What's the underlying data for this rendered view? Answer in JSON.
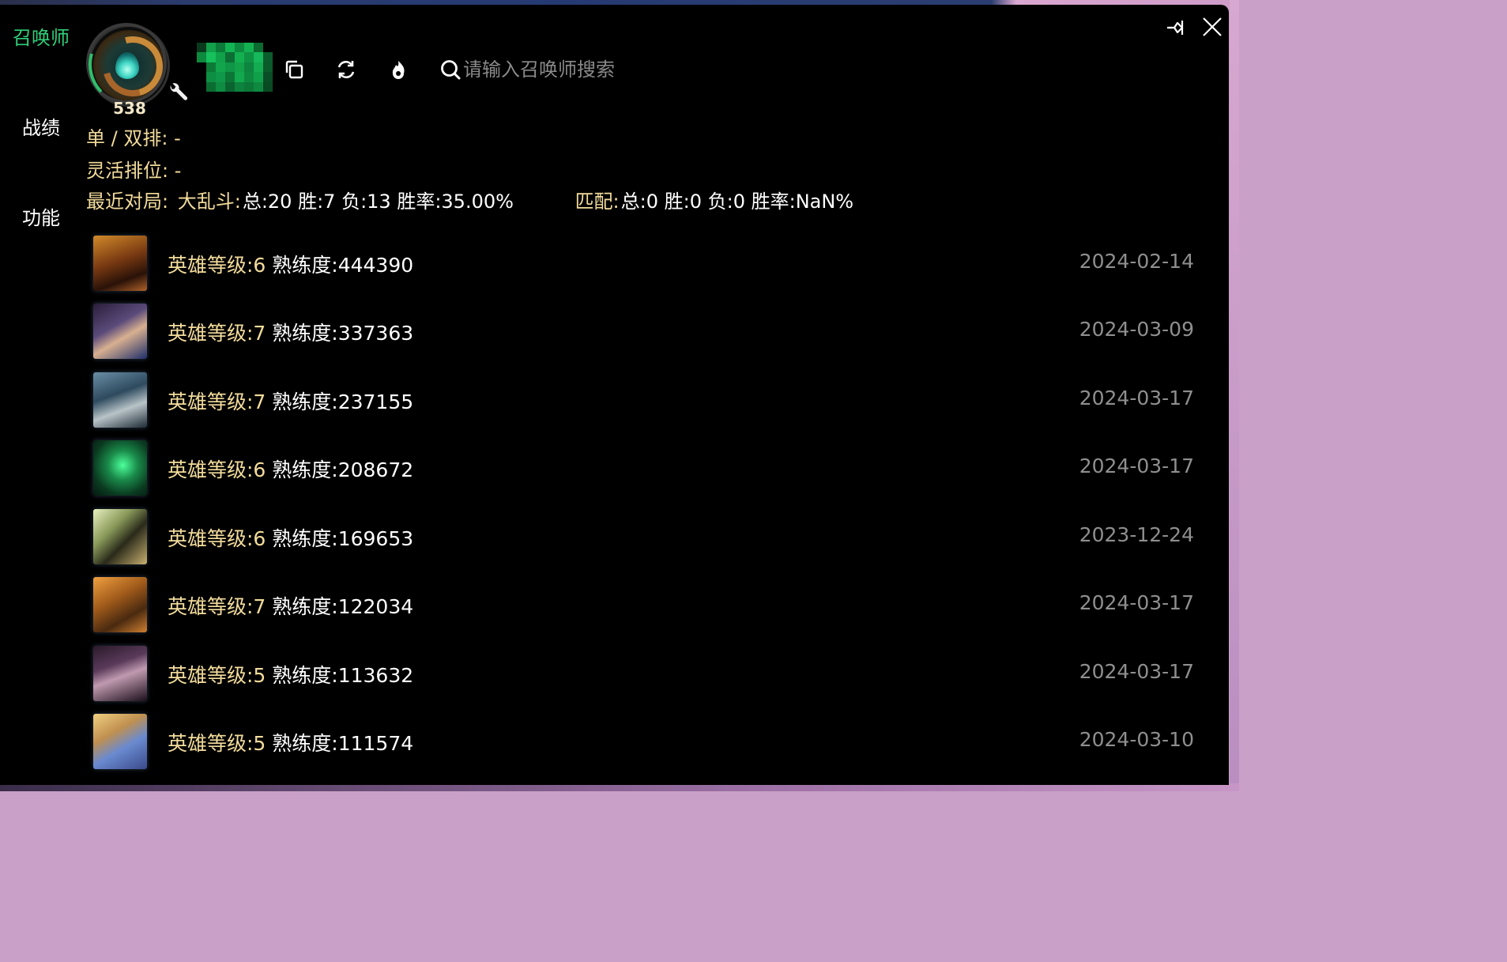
{
  "sidebar": {
    "items": [
      {
        "label": "召唤师",
        "active": true
      },
      {
        "label": "战绩",
        "active": false
      },
      {
        "label": "功能",
        "active": false
      }
    ]
  },
  "header": {
    "summoner_level": "538",
    "search_placeholder": "请输入召唤师搜索",
    "icons": [
      "profile-settings-icon",
      "copy-icon",
      "refresh-icon",
      "flame-icon",
      "search-icon",
      "pin-icon",
      "close-icon"
    ]
  },
  "ranks": {
    "solo_label": "单 / 双排:",
    "solo_value": "-",
    "flex_label": "灵活排位:",
    "flex_value": "-"
  },
  "recent": {
    "label": "最近对局:",
    "aram_label": "大乱斗:",
    "aram_stats": "总:20 胜:7 负:13 胜率:35.00%",
    "match_label": "匹配:",
    "match_stats": "总:0 胜:0 负:0 胜率:NaN%"
  },
  "champions": [
    {
      "level_label": "英雄等级:6",
      "mastery": "熟练度:444390",
      "date": "2024-02-14"
    },
    {
      "level_label": "英雄等级:7",
      "mastery": "熟练度:337363",
      "date": "2024-03-09"
    },
    {
      "level_label": "英雄等级:7",
      "mastery": "熟练度:237155",
      "date": "2024-03-17"
    },
    {
      "level_label": "英雄等级:6",
      "mastery": "熟练度:208672",
      "date": "2024-03-17"
    },
    {
      "level_label": "英雄等级:6",
      "mastery": "熟练度:169653",
      "date": "2023-12-24"
    },
    {
      "level_label": "英雄等级:7",
      "mastery": "熟练度:122034",
      "date": "2024-03-17"
    },
    {
      "level_label": "英雄等级:5",
      "mastery": "熟练度:113632",
      "date": "2024-03-17"
    },
    {
      "level_label": "英雄等级:5",
      "mastery": "熟练度:111574",
      "date": "2024-03-10"
    }
  ],
  "colors": {
    "accent_green": "#2fd07a",
    "gold_text": "#f3dc9b",
    "date_gray": "#8f8f8f",
    "window_bg": "#000000"
  }
}
